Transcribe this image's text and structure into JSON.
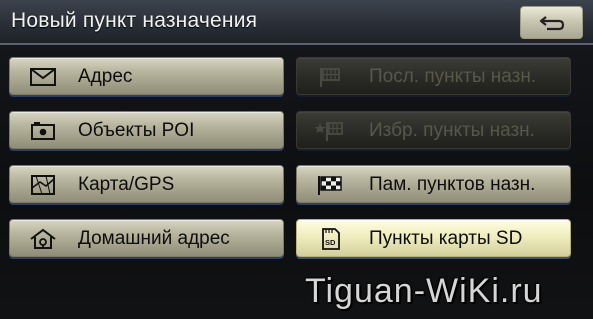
{
  "header": {
    "title": "Новый пункт назначения",
    "back_icon": "return-arrow-icon"
  },
  "left_column": [
    {
      "label": "Адрес",
      "icon": "envelope-icon",
      "state": "enabled"
    },
    {
      "label": "Объекты POI",
      "icon": "camera-icon",
      "state": "enabled"
    },
    {
      "label": "Карта/GPS",
      "icon": "map-icon",
      "state": "enabled"
    },
    {
      "label": "Домашний адрес",
      "icon": "home-icon",
      "state": "enabled"
    }
  ],
  "right_column": [
    {
      "label": "Посл. пункты назн.",
      "icon": "flag-icon",
      "state": "disabled"
    },
    {
      "label": "Избр. пункты назн.",
      "icon": "favorite-flag-icon",
      "state": "disabled"
    },
    {
      "label": "Пам. пунктов назн.",
      "icon": "checkered-flag-icon",
      "state": "enabled"
    },
    {
      "label": "Пункты карты SD",
      "icon": "sd-card-icon",
      "state": "selected"
    }
  ],
  "watermark": "Tiguan-WiKi.ru"
}
